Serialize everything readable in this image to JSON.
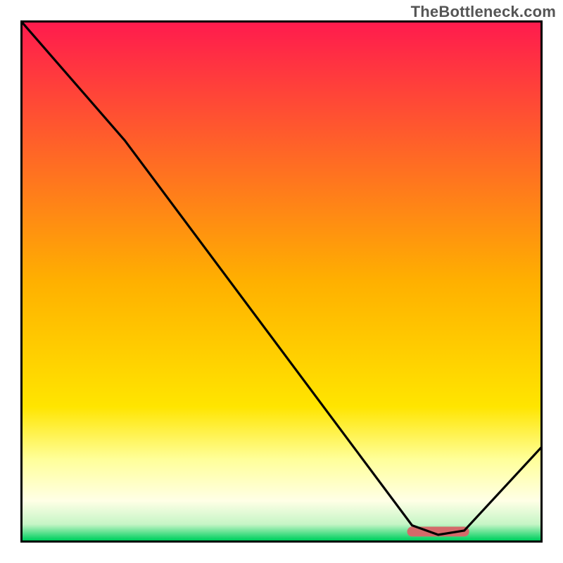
{
  "watermark": "TheBottleneck.com",
  "chart_data": {
    "type": "line",
    "title": "",
    "xlabel": "",
    "ylabel": "",
    "xlim": [
      0,
      100
    ],
    "ylim": [
      0,
      100
    ],
    "x": [
      0,
      20,
      75,
      80,
      85,
      100
    ],
    "values": [
      100,
      77,
      3.3,
      1.5,
      2.3,
      18.5
    ],
    "optimum_band": {
      "x_start": 75,
      "x_end": 85,
      "y": 2.1
    },
    "background_gradient": {
      "stops": [
        {
          "offset": 0.0,
          "color": "#ff1a4e"
        },
        {
          "offset": 0.5,
          "color": "#ffb000"
        },
        {
          "offset": 0.74,
          "color": "#ffe500"
        },
        {
          "offset": 0.84,
          "color": "#ffff99"
        },
        {
          "offset": 0.92,
          "color": "#ffffe6"
        },
        {
          "offset": 0.965,
          "color": "#c6f5c6"
        },
        {
          "offset": 0.995,
          "color": "#00d060"
        },
        {
          "offset": 1.0,
          "color": "#00c050"
        }
      ]
    },
    "frame_color": "#000000",
    "line_color": "#000000",
    "line_width": 3.2,
    "optimum_color": "#d46a6a",
    "optimum_thickness": 14
  }
}
